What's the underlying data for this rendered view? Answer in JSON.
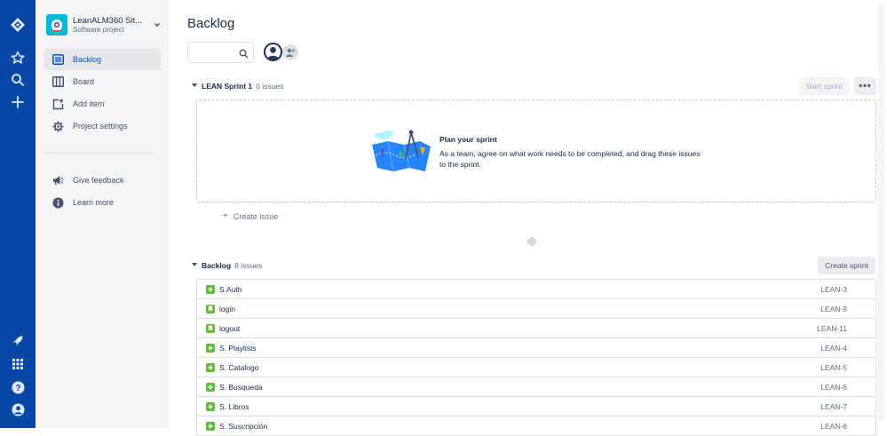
{
  "global_nav": {
    "icons": [
      "jira-logo-icon",
      "star-icon",
      "search-icon",
      "plus-icon",
      "rocket-icon",
      "app-switcher-icon",
      "help-icon",
      "profile-icon"
    ]
  },
  "sidebar": {
    "project_name": "LeanALM360 Sit...",
    "project_type": "Software project",
    "items": [
      {
        "label": "Backlog",
        "icon": "backlog-icon",
        "active": true
      },
      {
        "label": "Board",
        "icon": "board-icon",
        "active": false
      },
      {
        "label": "Add item",
        "icon": "add-item-icon",
        "active": false
      },
      {
        "label": "Project settings",
        "icon": "gear-icon",
        "active": false
      }
    ],
    "secondary": [
      {
        "label": "Give feedback",
        "icon": "megaphone-icon"
      },
      {
        "label": "Learn more",
        "icon": "info-icon"
      }
    ]
  },
  "main": {
    "title": "Backlog",
    "search": {
      "value": "",
      "placeholder": ""
    },
    "sprint": {
      "name": "LEAN Sprint 1",
      "count": "0 issues",
      "start_button": "Start sprint",
      "more_button": "•••",
      "empty_title": "Plan your sprint",
      "empty_body": "As a team, agree on what work needs to be completed, and drag these issues to the sprint."
    },
    "create_issue": "Create issue",
    "backlog": {
      "name": "Backlog",
      "count": "8 issues",
      "create_sprint_button": "Create sprint",
      "issues": [
        {
          "summary": "S.Auth",
          "key": "LEAN-3"
        },
        {
          "summary": "login",
          "key": "LEAN-9"
        },
        {
          "summary": "logout",
          "key": "LEAN-11"
        },
        {
          "summary": "S. Playlists",
          "key": "LEAN-4"
        },
        {
          "summary": "S. Catalogo",
          "key": "LEAN-5"
        },
        {
          "summary": "S. Busqueda",
          "key": "LEAN-6"
        },
        {
          "summary": "S. Libros",
          "key": "LEAN-7"
        },
        {
          "summary": "S. Suscripción",
          "key": "LEAN-8"
        }
      ]
    }
  },
  "colors": {
    "global_nav": "#0747a6",
    "sidebar_bg": "#f4f5f7",
    "accent": "#0052cc",
    "story_green": "#63ba3c"
  }
}
